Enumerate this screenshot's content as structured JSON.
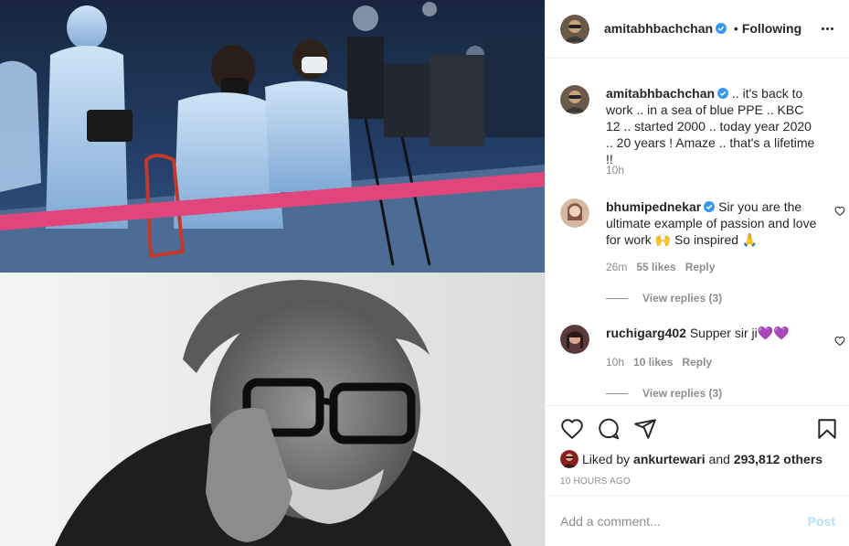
{
  "post": {
    "author": "amitabhbachchan",
    "follow_status": "Following",
    "caption": ".. it's back to work .. in a sea of blue PPE .. KBC 12 .. started 2000 .. today year 2020 .. 20 years ! Amaze .. that's a lifetime !!",
    "caption_time": "10h"
  },
  "comments": [
    {
      "user": "bhumipednekar",
      "verified": true,
      "text": "Sir you are the ultimate example of passion and love for work 🙌 So inspired 🙏",
      "time": "26m",
      "likes": "55 likes",
      "reply": "Reply",
      "view_replies": "View replies (3)"
    },
    {
      "user": "ruchigarg402",
      "verified": false,
      "text": "Supper sir ji💜💜",
      "time": "10h",
      "likes": "10 likes",
      "reply": "Reply",
      "view_replies": "View replies (3)"
    }
  ],
  "likes_line": {
    "prefix": "Liked by",
    "user": "ankurtewari",
    "and": "and",
    "count": "293,812 others"
  },
  "timestamp": "10 HOURS AGO",
  "add_comment": {
    "placeholder": "Add a comment...",
    "post_label": "Post"
  },
  "icons": {
    "verified": "verified-badge-icon",
    "more": "more-options-icon",
    "like": "heart-icon",
    "comment": "comment-icon",
    "share": "share-icon",
    "save": "bookmark-icon"
  },
  "colors": {
    "verified_blue": "#3897f0",
    "muted_text": "#8e8e8e",
    "post_button": "#b2dffc",
    "ppe_blue": "#7fa9d6",
    "barrier_pink": "#e0457b"
  }
}
